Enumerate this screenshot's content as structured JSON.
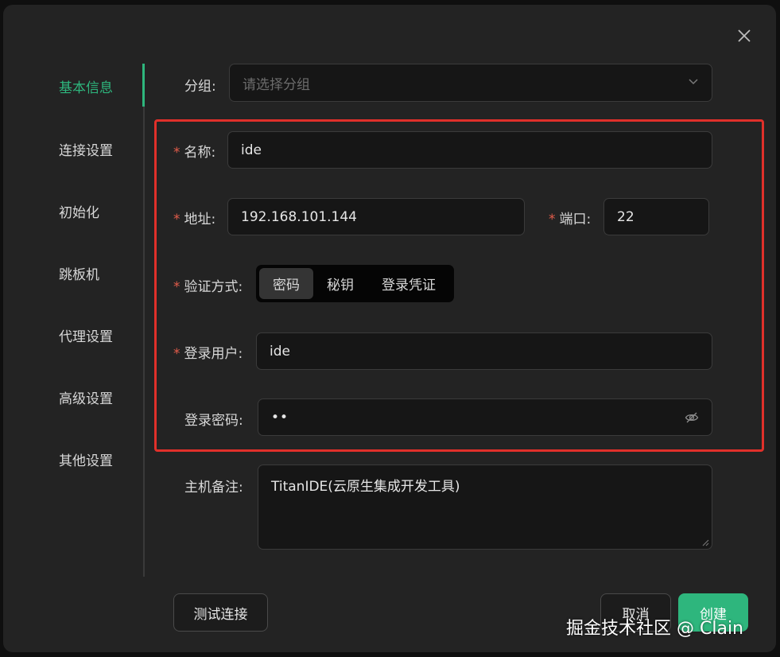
{
  "sidebar": {
    "items": [
      {
        "label": "基本信息",
        "active": true
      },
      {
        "label": "连接设置"
      },
      {
        "label": "初始化"
      },
      {
        "label": "跳板机"
      },
      {
        "label": "代理设置"
      },
      {
        "label": "高级设置"
      },
      {
        "label": "其他设置"
      }
    ]
  },
  "form": {
    "group": {
      "label": "分组:",
      "placeholder": "请选择分组"
    },
    "name": {
      "label": "名称:",
      "value": "ide"
    },
    "address": {
      "label": "地址:",
      "value": "192.168.101.144"
    },
    "port": {
      "label": "端口:",
      "value": "22"
    },
    "auth": {
      "label": "验证方式:",
      "options": [
        "密码",
        "秘钥",
        "登录凭证"
      ],
      "selected": "密码"
    },
    "user": {
      "label": "登录用户:",
      "value": "ide"
    },
    "password": {
      "label": "登录密码:",
      "value": "••"
    },
    "note": {
      "label": "主机备注:",
      "value": "TitanIDE(云原生集成开发工具)"
    },
    "required_mark": "*"
  },
  "footer": {
    "test_label": "测试连接",
    "cancel_label": "取消",
    "create_label": "创建"
  },
  "watermark": "掘金技术社区 @ Clain",
  "colors": {
    "accent": "#2eb67d",
    "highlight": "#e0302a",
    "required": "#e25c4a",
    "background": "#232323"
  },
  "icons": [
    "close-icon",
    "chevron-down-icon",
    "eye-off-icon"
  ]
}
